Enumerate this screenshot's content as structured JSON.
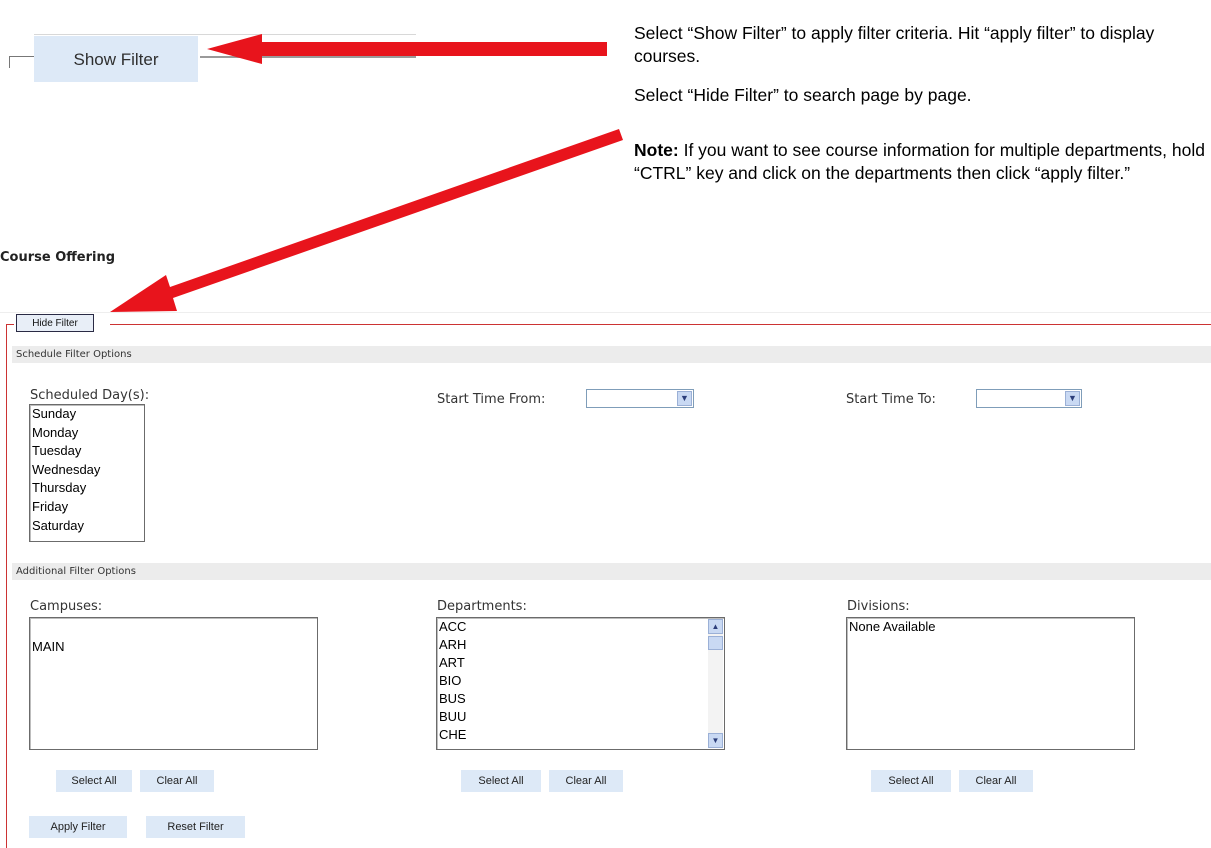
{
  "top_example": {
    "show_filter_label": "Show Filter"
  },
  "instructions": {
    "show_text": "Select “Show Filter” to apply filter criteria. Hit “apply filter” to display courses.",
    "hide_text": "Select “Hide Filter” to search page by page.",
    "note_label": "Note:",
    "note_text": " If you want to see course information for multiple departments, hold “CTRL” key and click on the departments then click “apply filter.”"
  },
  "page": {
    "title": "Course Offering"
  },
  "filter": {
    "hide_filter_label": "Hide Filter",
    "schedule_section": "Schedule Filter Options",
    "scheduled_days_label": "Scheduled Day(s):",
    "days": [
      "Sunday",
      "Monday",
      "Tuesday",
      "Wednesday",
      "Thursday",
      "Friday",
      "Saturday"
    ],
    "start_time_from_label": "Start Time From:",
    "start_time_from_value": "",
    "start_time_to_label": "Start Time To:",
    "start_time_to_value": "",
    "additional_section": "Additional Filter Options",
    "campuses_label": "Campuses:",
    "campuses": [
      "MAIN"
    ],
    "departments_label": "Departments:",
    "departments": [
      "ACC",
      "ARH",
      "ART",
      "BIO",
      "BUS",
      "BUU",
      "CHE"
    ],
    "divisions_label": "Divisions:",
    "divisions": [
      "None Available"
    ],
    "select_all_label": "Select All",
    "clear_all_label": "Clear All",
    "apply_filter_label": "Apply Filter",
    "reset_filter_label": "Reset Filter"
  },
  "colors": {
    "arrow": "#e8141c",
    "panel_border": "#cc3333",
    "button_bg": "#dde9f7"
  },
  "icons": {
    "dropdown": "chevron-down-icon",
    "scroll_up": "scroll-up-icon",
    "scroll_down": "scroll-down-icon",
    "annotation_arrow": "red-arrow-icon"
  }
}
